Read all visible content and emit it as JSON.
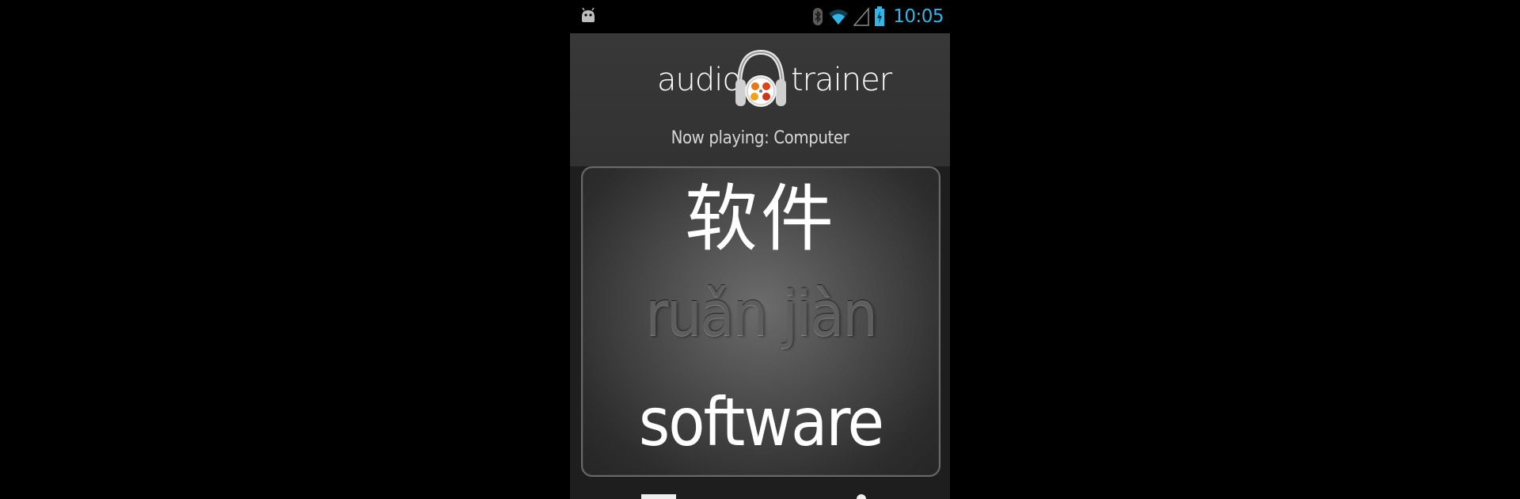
{
  "status_bar": {
    "time": "10:05",
    "clock_color": "#33b5e5",
    "icons": [
      "android-debug-icon",
      "bluetooth-icon",
      "wifi-icon",
      "signal-icon",
      "battery-charging-icon"
    ]
  },
  "app": {
    "logo_left": "audio",
    "logo_right": "trainer",
    "logo_icon": "headphones-icon",
    "now_playing": "Now playing: Computer"
  },
  "card": {
    "hanzi": "软件",
    "pinyin": "ruǎn jiàn",
    "english": "software"
  },
  "colors": {
    "background": "#000000",
    "header": "#363636",
    "text": "#ffffff",
    "pinyin": "#5e5e5e"
  }
}
